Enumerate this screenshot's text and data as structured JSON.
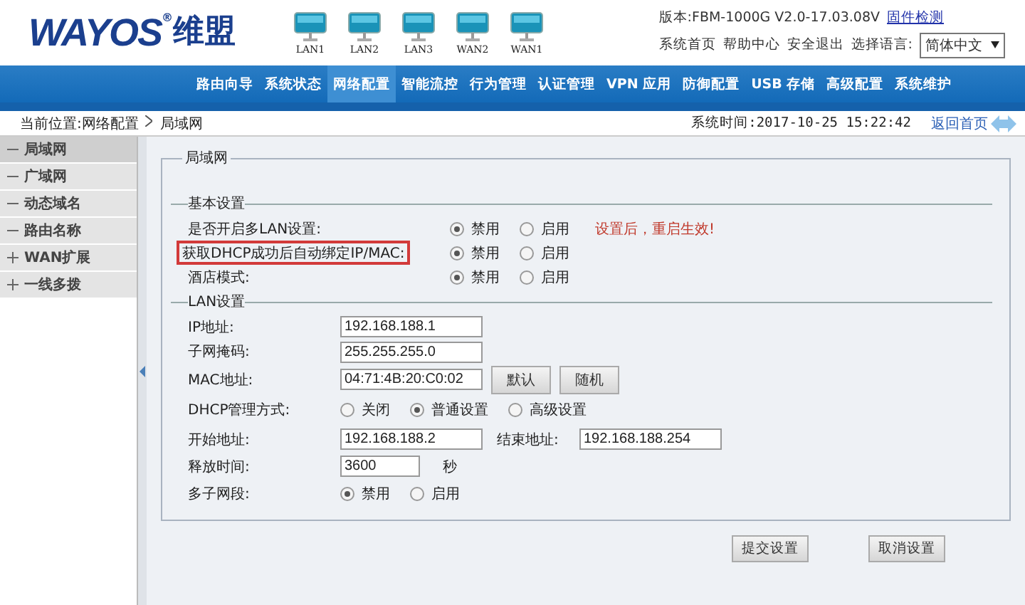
{
  "header": {
    "logo": {
      "brand": "WAYOS",
      "mark": "®",
      "name": "维盟"
    },
    "ports": [
      {
        "label": "LAN1"
      },
      {
        "label": "LAN2"
      },
      {
        "label": "LAN3"
      },
      {
        "label": "WAN2"
      },
      {
        "label": "WAN1"
      }
    ],
    "version": "版本:FBM-1000G V2.0-17.03.08V",
    "firmware_link": "固件检测",
    "links": [
      "系统首页",
      "帮助中心",
      "安全退出"
    ],
    "language": {
      "label": "选择语言:",
      "value": "简体中文"
    }
  },
  "nav": [
    {
      "label": "路由向导",
      "selected": false
    },
    {
      "label": "系统状态",
      "selected": false
    },
    {
      "label": "网络配置",
      "selected": true
    },
    {
      "label": "智能流控",
      "selected": false
    },
    {
      "label": "行为管理",
      "selected": false
    },
    {
      "label": "认证管理",
      "selected": false
    },
    {
      "label": "VPN 应用",
      "selected": false
    },
    {
      "label": "防御配置",
      "selected": false
    },
    {
      "label": "USB 存储",
      "selected": false
    },
    {
      "label": "高级配置",
      "selected": false
    },
    {
      "label": "系统维护",
      "selected": false
    }
  ],
  "breadcrumb": {
    "location": "当前位置:网络配置",
    "current": "局域网"
  },
  "system_time": "系统时间:2017-10-25 15:22:42",
  "home_link": "返回首页",
  "sidebar": {
    "items": [
      {
        "label": "局域网",
        "expanded": true,
        "selected": true
      },
      {
        "label": "广域网",
        "expanded": true,
        "selected": false
      },
      {
        "label": "动态域名",
        "expanded": true,
        "selected": false
      },
      {
        "label": "路由名称",
        "expanded": true,
        "selected": false
      },
      {
        "label": "WAN扩展",
        "expanded": false,
        "selected": false
      },
      {
        "label": "一线多拨",
        "expanded": false,
        "selected": false
      }
    ]
  },
  "panel": {
    "title": "局域网",
    "basic": {
      "title": "基本设置",
      "rows": [
        {
          "label": "是否开启多LAN设置:",
          "highlighted": false,
          "options": [
            {
              "label": "禁用",
              "selected": true
            },
            {
              "label": "启用",
              "selected": false
            }
          ],
          "note": "设置后，重启生效!"
        },
        {
          "label": "获取DHCP成功后自动绑定IP/MAC:",
          "highlighted": true,
          "options": [
            {
              "label": "禁用",
              "selected": true
            },
            {
              "label": "启用",
              "selected": false
            }
          ]
        },
        {
          "label": "酒店模式:",
          "highlighted": false,
          "options": [
            {
              "label": "禁用",
              "selected": true
            },
            {
              "label": "启用",
              "selected": false
            }
          ]
        }
      ]
    },
    "lan": {
      "title": "LAN设置",
      "rows": [
        {
          "kind": "input",
          "label": "IP地址:",
          "value": "192.168.188.1"
        },
        {
          "kind": "input",
          "label": "子网掩码:",
          "value": "255.255.255.0"
        },
        {
          "kind": "input_buttons",
          "label": "MAC地址:",
          "value": "04:71:4B:20:C0:02",
          "buttons": [
            "默认",
            "随机"
          ]
        },
        {
          "kind": "radio",
          "label": "DHCP管理方式:",
          "options": [
            {
              "label": "关闭",
              "selected": false
            },
            {
              "label": "普通设置",
              "selected": true
            },
            {
              "label": "高级设置",
              "selected": false
            }
          ]
        },
        {
          "kind": "range",
          "label": "开始地址:",
          "value": "192.168.188.2",
          "end_label": "结束地址:",
          "end_value": "192.168.188.254"
        },
        {
          "kind": "input_unit",
          "label": "释放时间:",
          "value": "3600",
          "unit": "秒"
        },
        {
          "kind": "radio",
          "label": "多子网段:",
          "options": [
            {
              "label": "禁用",
              "selected": true
            },
            {
              "label": "启用",
              "selected": false
            }
          ]
        }
      ]
    }
  },
  "buttons": [
    "提交设置",
    "取消设置"
  ]
}
